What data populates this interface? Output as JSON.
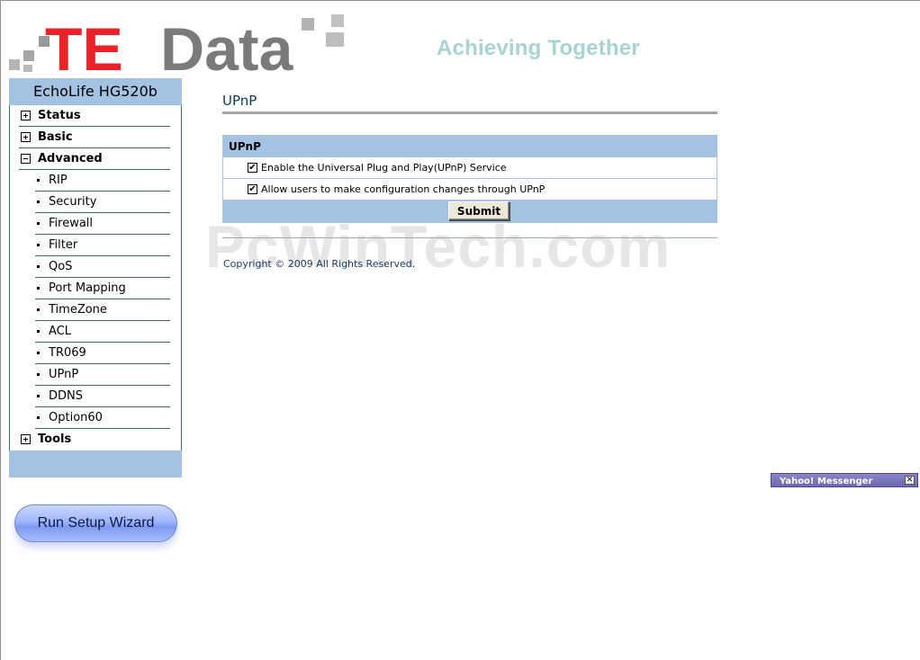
{
  "brand": {
    "logo_text_te": "TE",
    "logo_text_data": "Data",
    "slogan": "Achieving Together",
    "colors": {
      "te_red": "#ec2229",
      "data_gray": "#7a7a7a",
      "slogan": "#a9d3d3",
      "accent_blue": "#a4c2e2"
    }
  },
  "sidebar": {
    "model": "EchoLife HG520b",
    "items": [
      {
        "label": "Status",
        "expanded": false
      },
      {
        "label": "Basic",
        "expanded": false
      },
      {
        "label": "Advanced",
        "expanded": true
      },
      {
        "label": "Tools",
        "expanded": false
      }
    ],
    "advanced_items": [
      "RIP",
      "Security",
      "Firewall",
      "Filter",
      "QoS",
      "Port Mapping",
      "TimeZone",
      "ACL",
      "TR069",
      "UPnP",
      "DDNS",
      "Option60"
    ],
    "wizard_label": "Run Setup Wizard"
  },
  "main": {
    "title": "UPnP",
    "panel_title": "UPnP",
    "options": [
      {
        "label": "Enable the Universal Plug and Play(UPnP) Service",
        "checked": true
      },
      {
        "label": "Allow users to make configuration changes through UPnP",
        "checked": true
      }
    ],
    "submit_label": "Submit",
    "copyright": "Copyright © 2009 All Rights Reserved."
  },
  "overlay": {
    "watermark": "PcWinTech.com",
    "messenger_title": "Yahoo! Messenger",
    "close_glyph": "✕"
  }
}
